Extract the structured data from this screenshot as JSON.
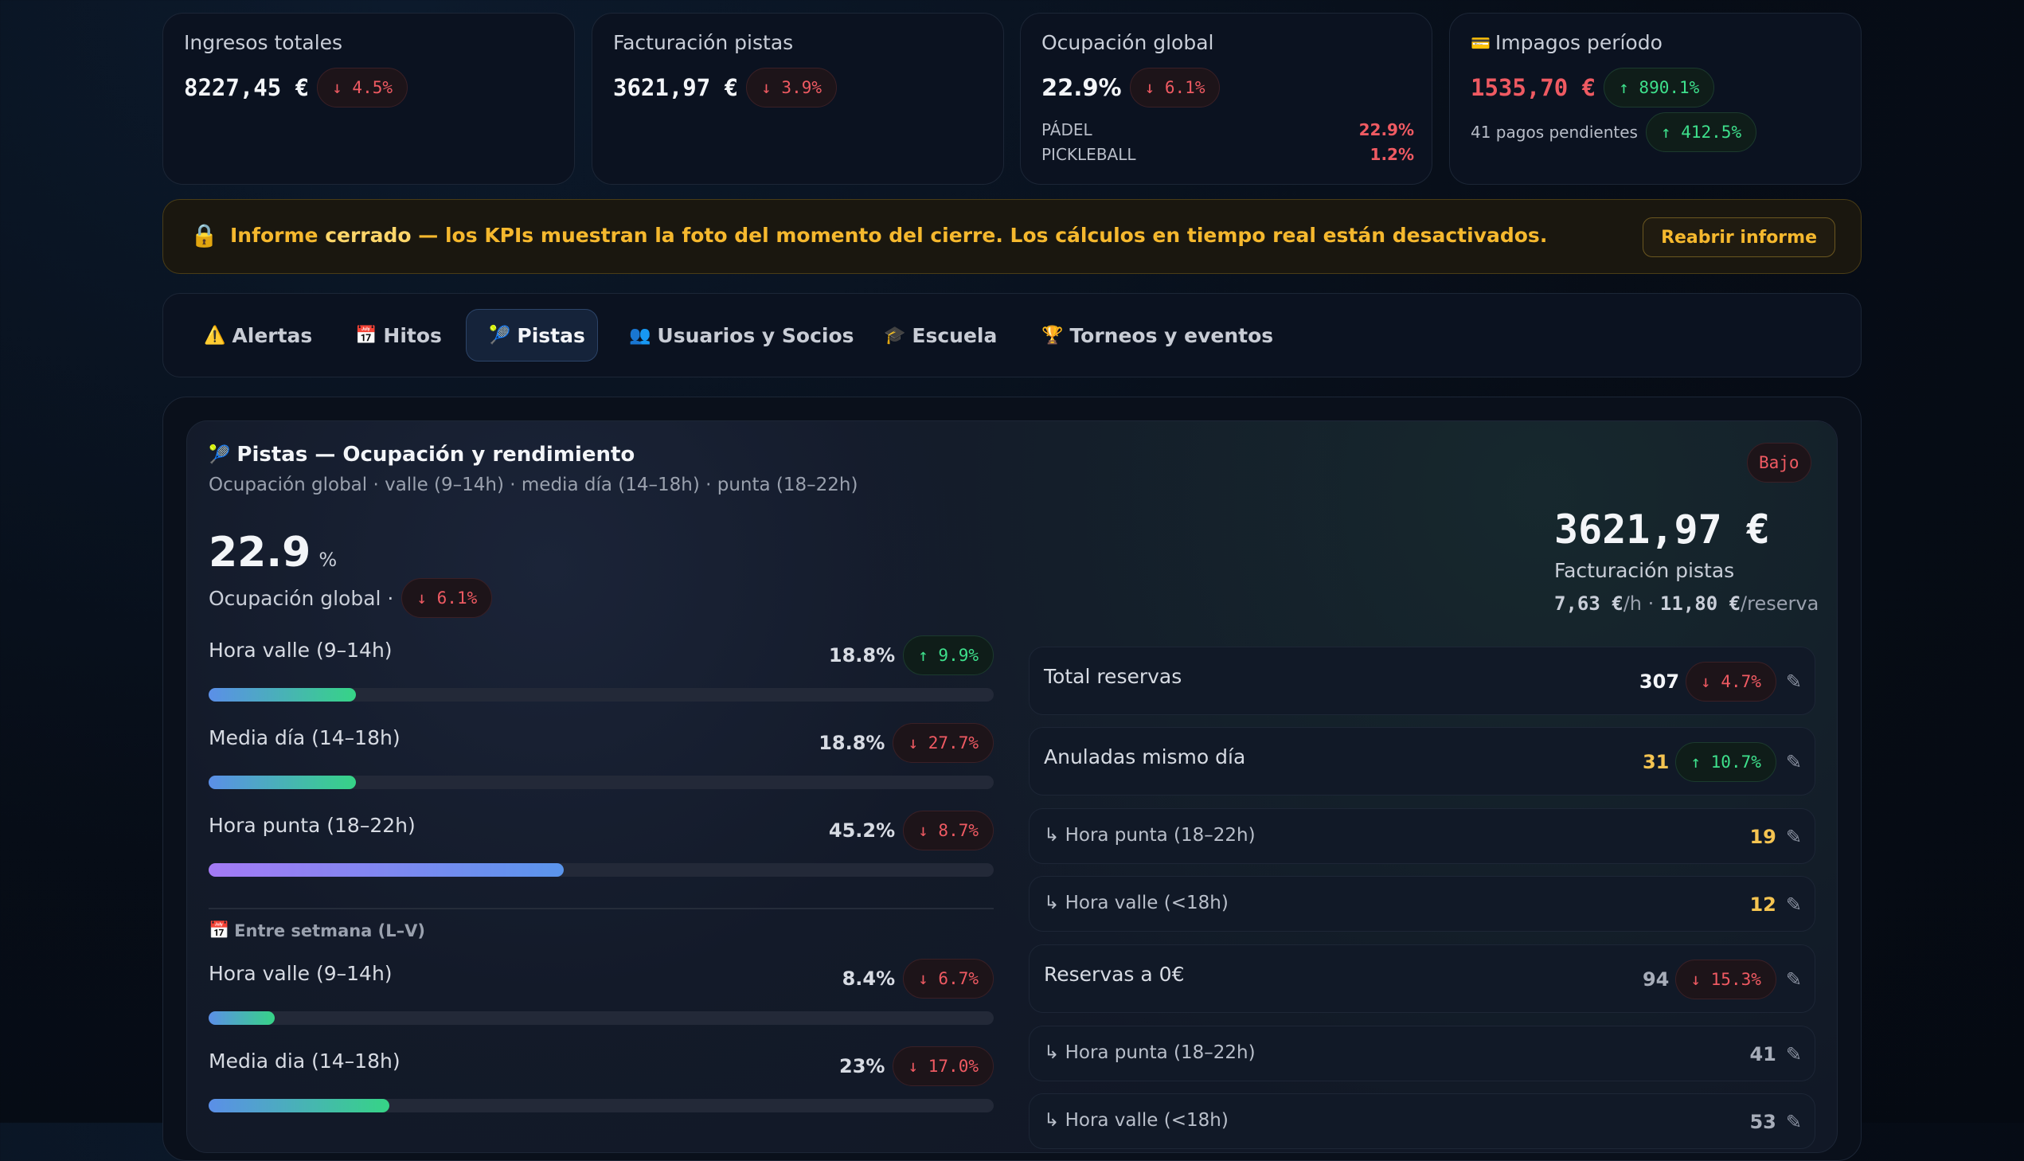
{
  "kpis": {
    "ingresos": {
      "label": "Ingresos totales",
      "value": "8227,45 €",
      "delta": "↓ 4.5%"
    },
    "facturacion": {
      "label": "Facturación pistas",
      "value": "3621,97 €",
      "delta": "↓ 3.9%"
    },
    "ocupacion": {
      "label": "Ocupación global",
      "value": "22.9%",
      "delta": "↓ 6.1%",
      "padel_label": "PÁDEL",
      "padel_value": "22.9%",
      "pickle_label": "PICKLEBALL",
      "pickle_value": "1.2%"
    },
    "impagos": {
      "icon": "💳",
      "label": "Impagos período",
      "value": "1535,70 €",
      "delta": "↑ 890.1%",
      "pending_label": "41 pagos pendientes",
      "pending_delta": "↑ 412.5%"
    }
  },
  "banner": {
    "icon": "🔒",
    "prefix": "Informe ",
    "strong": "cerrado",
    "rest": " — los KPIs muestran la foto del momento del cierre. Los cálculos en tiempo real están desactivados.",
    "button": "Reabrir informe"
  },
  "tabs": [
    {
      "icon": "⚠️",
      "label": "Alertas"
    },
    {
      "icon": "📅",
      "label": "Hitos"
    },
    {
      "icon": "🎾",
      "label": "Pistas"
    },
    {
      "icon": "👥",
      "label": "Usuarios y Socios"
    },
    {
      "icon": "🎓",
      "label": "Escuela"
    },
    {
      "icon": "🏆",
      "label": "Torneos y eventos"
    }
  ],
  "panel": {
    "icon": "🎾",
    "title": "Pistas — Ocupación y rendimiento",
    "subtitle": "Ocupación global · valle (9–14h) · media día (14–18h) · punta (18–22h)",
    "badge": "Bajo",
    "big_value": "22.9",
    "big_unit": "%",
    "big_label": "Ocupación global ·",
    "big_delta": "↓ 6.1%",
    "revenue_value": "3621,97 €",
    "revenue_label": "Facturación pistas",
    "rate_h": "7,63 €",
    "rate_h_unit": "/h · ",
    "rate_r": "11,80 €",
    "rate_r_unit": "/reserva"
  },
  "bars": [
    {
      "label": "Hora valle (9–14h)",
      "value": "18.8%",
      "fraction": 0.188,
      "delta": "↑ 9.9%",
      "dir": "up",
      "style": "g"
    },
    {
      "label": "Media día (14–18h)",
      "value": "18.8%",
      "fraction": 0.188,
      "delta": "↓ 27.7%",
      "dir": "down",
      "style": "g"
    },
    {
      "label": "Hora punta (18–22h)",
      "value": "45.2%",
      "fraction": 0.452,
      "delta": "↓ 8.7%",
      "dir": "down",
      "style": "p"
    }
  ],
  "weekday": {
    "icon": "📅",
    "title": "Entre setmana (L–V)",
    "bars": [
      {
        "label": "Hora valle (9–14h)",
        "value": "8.4%",
        "fraction": 0.084,
        "delta": "↓ 6.7%",
        "dir": "down",
        "style": "g"
      },
      {
        "label": "Media dia (14–18h)",
        "value": "23%",
        "fraction": 0.23,
        "delta": "↓ 17.0%",
        "dir": "down",
        "style": "g"
      }
    ]
  },
  "reservas": [
    {
      "label": "Total reservas",
      "value": "307",
      "delta": "↓ 4.7%",
      "dir": "down",
      "color": "#f3f5f8"
    },
    {
      "label": "Anuladas mismo día",
      "value": "31",
      "delta": "↑ 10.7%",
      "dir": "up",
      "color": "#f5c451"
    },
    {
      "label": "↳ Hora punta (18–22h)",
      "value": "19",
      "color": "#f5c451"
    },
    {
      "label": "↳ Hora valle (<18h)",
      "value": "12",
      "color": "#f5c451"
    },
    {
      "label": "Reservas a 0€",
      "value": "94",
      "delta": "↓ 15.3%",
      "dir": "down",
      "color": "#a7adb9"
    },
    {
      "label": "↳ Hora punta (18–22h)",
      "value": "41",
      "color": "#a7adb9"
    },
    {
      "label": "↳ Hora valle (<18h)",
      "value": "53",
      "color": "#a7adb9"
    }
  ],
  "colors": {
    "accent_warning": "#f5b82e",
    "negative": "#ef5a62",
    "positive": "#3ee08c"
  }
}
